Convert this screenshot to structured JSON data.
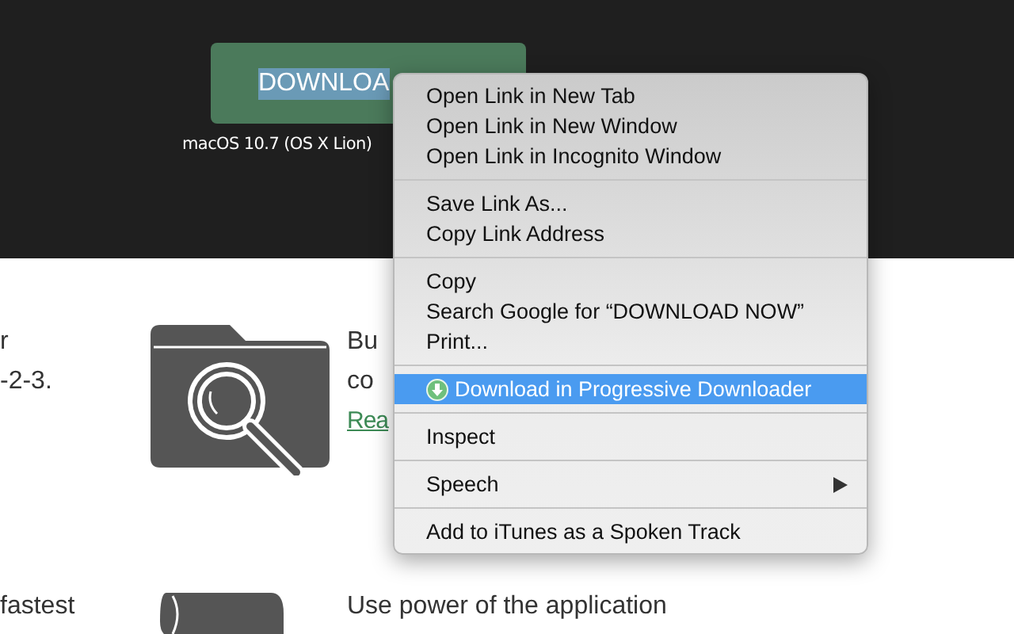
{
  "header": {
    "download_button": "DOWNLOA",
    "caption": "macOS 10.7 (OS X Lion)"
  },
  "features": [
    {
      "left_lines": [
        "r",
        "-2-3."
      ],
      "right_lines": [
        "Bu",
        "co"
      ],
      "link": "Rea"
    },
    {
      "left_lines": [
        "fastest"
      ],
      "right_lines": [
        "Use power of the application"
      ]
    }
  ],
  "context_menu": {
    "groups": [
      [
        {
          "label": "Open Link in New Tab",
          "selected": false
        },
        {
          "label": "Open Link in New Window",
          "selected": false
        },
        {
          "label": "Open Link in Incognito Window",
          "selected": false
        }
      ],
      [
        {
          "label": "Save Link As...",
          "selected": false
        },
        {
          "label": "Copy Link Address",
          "selected": false
        }
      ],
      [
        {
          "label": "Copy",
          "selected": false
        },
        {
          "label": "Search Google for “DOWNLOAD NOW”",
          "selected": false
        },
        {
          "label": "Print...",
          "selected": false
        }
      ],
      [
        {
          "label": "Download in Progressive Downloader",
          "selected": true,
          "has_icon": true
        }
      ],
      [
        {
          "label": "Inspect",
          "selected": false
        }
      ],
      [
        {
          "label": "Speech",
          "selected": false,
          "submenu": true
        }
      ],
      [
        {
          "label": "Add to iTunes as a Spoken Track",
          "selected": false
        }
      ]
    ]
  }
}
